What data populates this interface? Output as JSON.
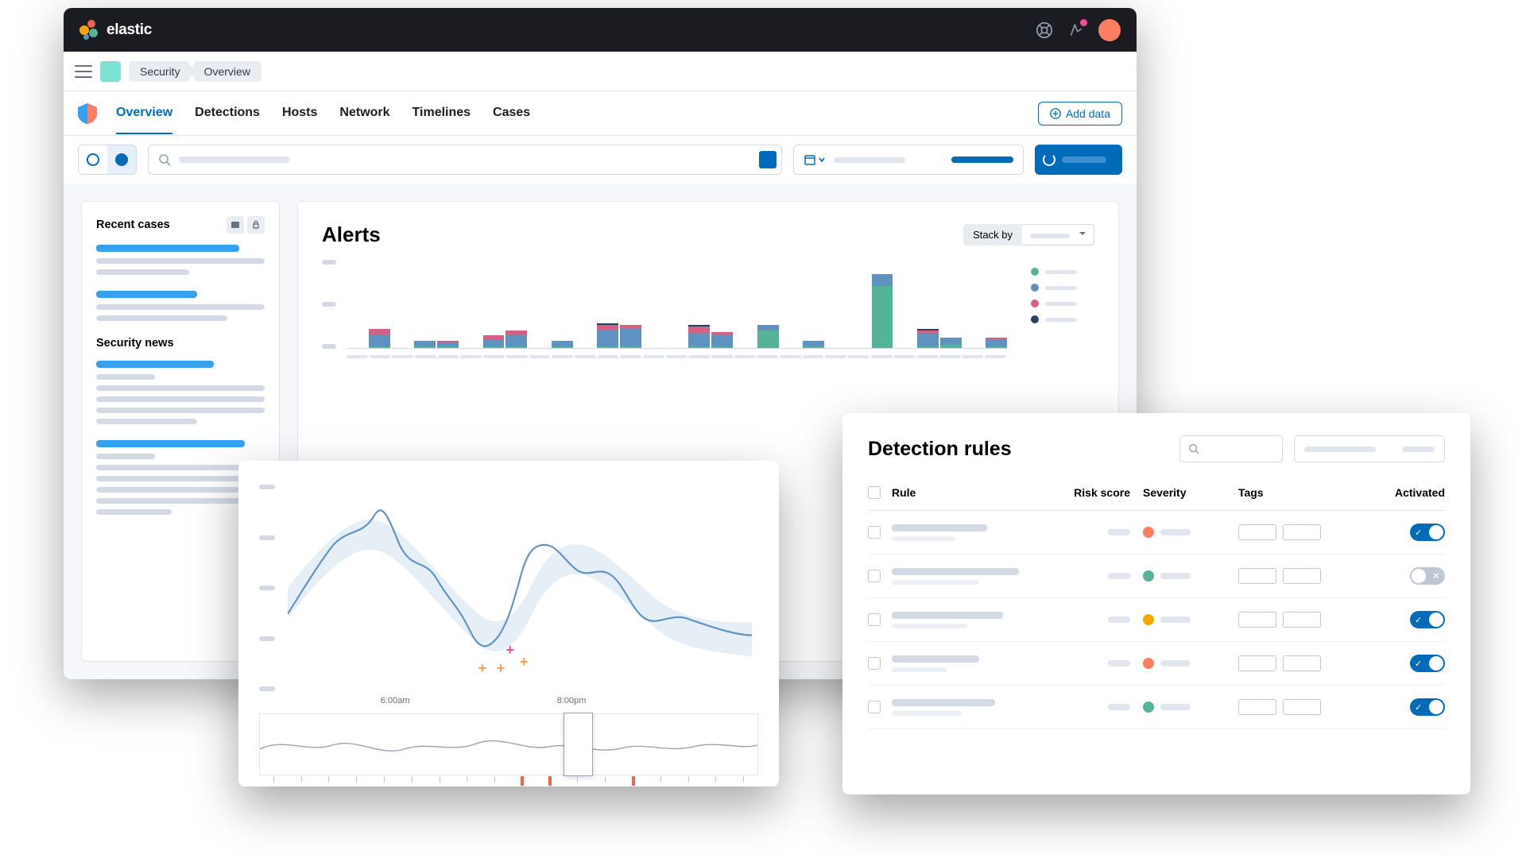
{
  "brand": "elastic",
  "breadcrumb": {
    "app": "Security",
    "page": "Overview"
  },
  "tabs": [
    "Overview",
    "Detections",
    "Hosts",
    "Network",
    "Timelines",
    "Cases"
  ],
  "active_tab": 0,
  "add_data": "Add data",
  "sidebar": {
    "recent_cases": "Recent cases",
    "security_news": "Security news"
  },
  "alerts": {
    "title": "Alerts",
    "stack_by": "Stack by"
  },
  "chart_data": {
    "type": "bar",
    "stacked": true,
    "series_colors": {
      "a": "#54b399",
      "b": "#6092c0",
      "c": "#d36086",
      "d": "#2c3e66"
    },
    "legend_colors": [
      "#54b399",
      "#6092c0",
      "#d36086",
      "#2c3e66"
    ],
    "bars": [
      {
        "a": 0,
        "b": 0,
        "c": 0,
        "d": 0
      },
      {
        "a": 2,
        "b": 12,
        "c": 8,
        "d": 0
      },
      {
        "a": 0,
        "b": 0,
        "c": 0,
        "d": 0
      },
      {
        "a": 2,
        "b": 6,
        "c": 0,
        "d": 0
      },
      {
        "a": 2,
        "b": 4,
        "c": 2,
        "d": 0
      },
      {
        "a": 0,
        "b": 0,
        "c": 0,
        "d": 0
      },
      {
        "a": 2,
        "b": 8,
        "c": 4,
        "d": 0
      },
      {
        "a": 2,
        "b": 12,
        "c": 6,
        "d": 0
      },
      {
        "a": 0,
        "b": 0,
        "c": 0,
        "d": 0
      },
      {
        "a": 2,
        "b": 6,
        "c": 0,
        "d": 0
      },
      {
        "a": 0,
        "b": 0,
        "c": 0,
        "d": 0
      },
      {
        "a": 2,
        "b": 18,
        "c": 6,
        "d": 2
      },
      {
        "a": 2,
        "b": 20,
        "c": 4,
        "d": 0
      },
      {
        "a": 0,
        "b": 0,
        "c": 0,
        "d": 0
      },
      {
        "a": 0,
        "b": 0,
        "c": 0,
        "d": 0
      },
      {
        "a": 2,
        "b": 14,
        "c": 8,
        "d": 2
      },
      {
        "a": 2,
        "b": 12,
        "c": 4,
        "d": 0
      },
      {
        "a": 0,
        "b": 0,
        "c": 0,
        "d": 0
      },
      {
        "a": 20,
        "b": 6,
        "c": 0,
        "d": 0
      },
      {
        "a": 0,
        "b": 0,
        "c": 0,
        "d": 0
      },
      {
        "a": 2,
        "b": 6,
        "c": 0,
        "d": 0
      },
      {
        "a": 0,
        "b": 0,
        "c": 0,
        "d": 0
      },
      {
        "a": 0,
        "b": 0,
        "c": 0,
        "d": 0
      },
      {
        "a": 70,
        "b": 14,
        "c": 0,
        "d": 0
      },
      {
        "a": 0,
        "b": 0,
        "c": 0,
        "d": 0
      },
      {
        "a": 2,
        "b": 14,
        "c": 4,
        "d": 2
      },
      {
        "a": 4,
        "b": 8,
        "c": 0,
        "d": 0
      },
      {
        "a": 0,
        "b": 0,
        "c": 0,
        "d": 0
      },
      {
        "a": 2,
        "b": 8,
        "c": 2,
        "d": 0
      }
    ],
    "ymax": 100
  },
  "line_chart": {
    "x_labels": {
      "left": "6:00am",
      "right": "8:00pm"
    },
    "anomalies": [
      {
        "x": 47,
        "y": 76,
        "color": "#f04e98"
      },
      {
        "x": 41,
        "y": 85,
        "color": "#ff9b63"
      },
      {
        "x": 45,
        "y": 85,
        "color": "#ff9b63"
      },
      {
        "x": 50,
        "y": 82,
        "color": "#ff9b63"
      }
    ]
  },
  "rules": {
    "title": "Detection rules",
    "columns": {
      "rule": "Rule",
      "risk": "Risk score",
      "severity": "Severity",
      "tags": "Tags",
      "activated": "Activated"
    },
    "rows": [
      {
        "name_w": 120,
        "sub_w": 80,
        "sev_color": "#ff7e62",
        "activated": true
      },
      {
        "name_w": 160,
        "sub_w": 110,
        "sev_color": "#54b399",
        "activated": false
      },
      {
        "name_w": 140,
        "sub_w": 95,
        "sev_color": "#f5a700",
        "activated": true
      },
      {
        "name_w": 110,
        "sub_w": 70,
        "sev_color": "#ff7e62",
        "activated": true
      },
      {
        "name_w": 130,
        "sub_w": 88,
        "sev_color": "#54b399",
        "activated": true
      }
    ]
  }
}
